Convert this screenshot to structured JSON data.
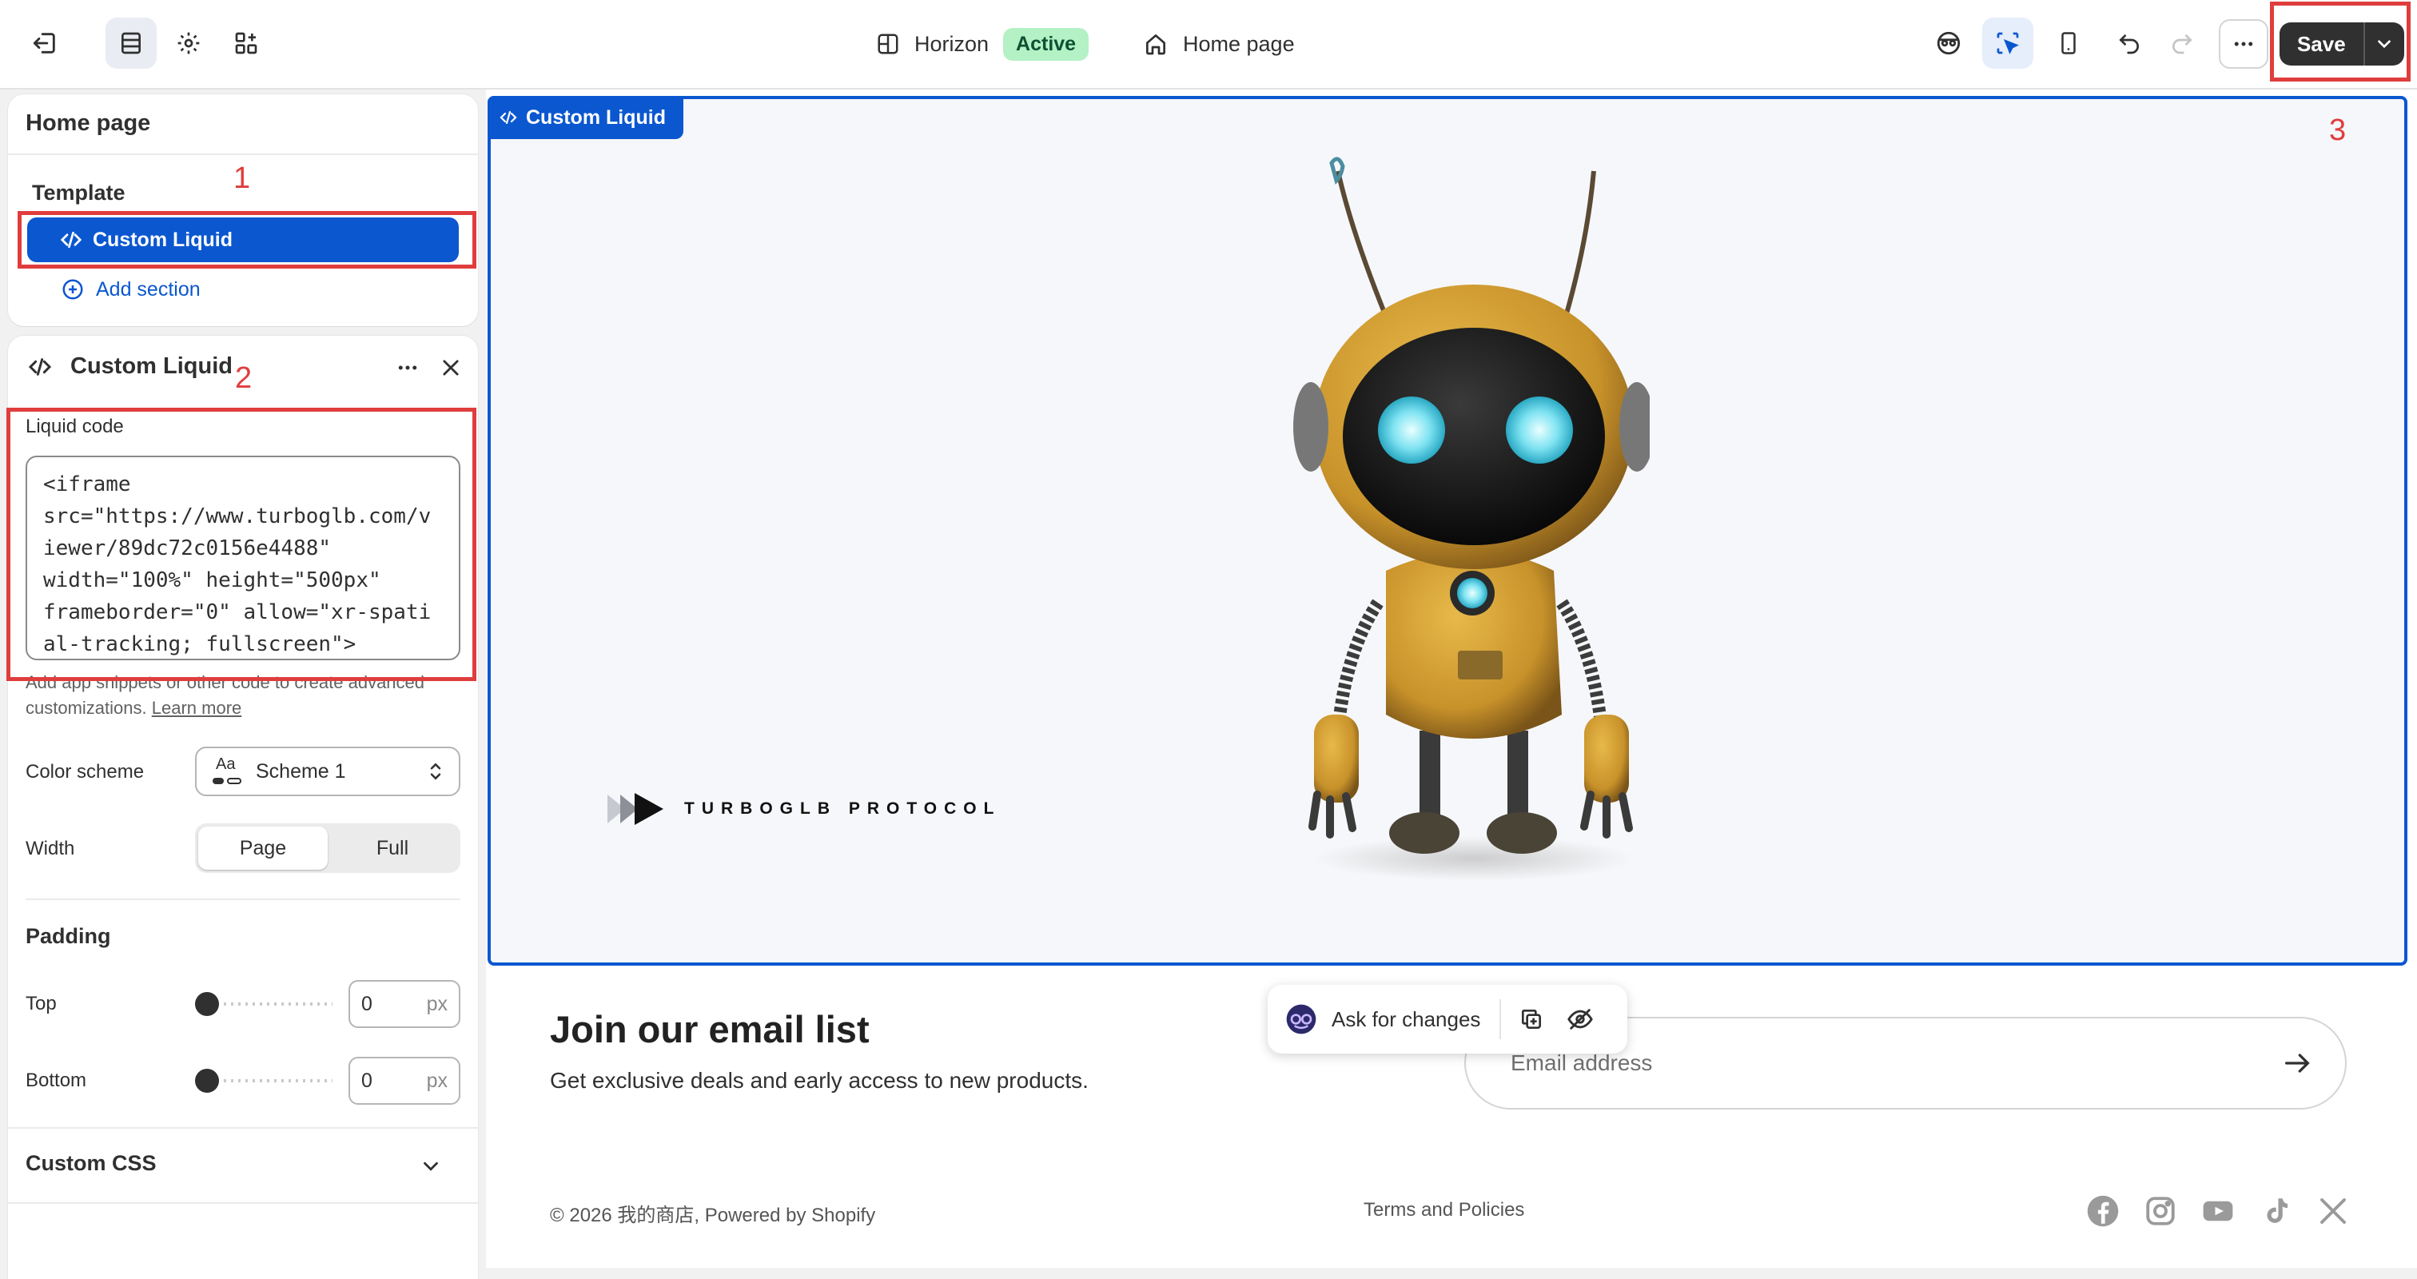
{
  "topbar": {
    "theme_name": "Horizon",
    "theme_status": "Active",
    "page_name": "Home page",
    "save_label": "Save"
  },
  "sidebar": {
    "page_title": "Home page",
    "template_label": "Template",
    "template_item": "Custom Liquid",
    "add_section": "Add section"
  },
  "section_settings": {
    "title": "Custom Liquid",
    "liquid_code_label": "Liquid code",
    "liquid_code_value": "<iframe\nsrc=\"https://www.turboglb.com/viewer/89dc72c0156e4488\"\nwidth=\"100%\" height=\"500px\"\nframeborder=\"0\" allow=\"xr-spatial-tracking; fullscreen\">",
    "help_text": "Add app snippets or other code to create advanced customizations.",
    "learn_more": "Learn more",
    "color_scheme_label": "Color scheme",
    "color_scheme_value": "Scheme 1",
    "color_scheme_swatch": "Aa",
    "width_label": "Width",
    "width_options": [
      "Page",
      "Full"
    ],
    "width_selected": "Page",
    "padding_heading": "Padding",
    "padding_top_label": "Top",
    "padding_top_value": "0",
    "padding_bottom_label": "Bottom",
    "padding_bottom_value": "0",
    "unit": "px",
    "custom_css_label": "Custom CSS"
  },
  "annotations": [
    "1",
    "2",
    "3"
  ],
  "preview": {
    "section_tag": "Custom Liquid",
    "brand_text": "TURBOGLB PROTOCOL",
    "email_title": "Join our email list",
    "email_subtitle": "Get exclusive deals and early access to new products.",
    "email_placeholder": "Email address",
    "ask_for_changes": "Ask for changes",
    "footer_copyright": "© 2026 我的商店, Powered by Shopify",
    "footer_terms": "Terms and Policies",
    "social_icons": [
      "facebook-icon",
      "instagram-icon",
      "youtube-icon",
      "tiktok-icon",
      "x-icon"
    ]
  },
  "colors": {
    "accent_blue": "#0b57d0",
    "annotation_red": "#e03d3d",
    "active_badge_bg": "#b4f1c5",
    "save_button_bg": "#303030"
  }
}
